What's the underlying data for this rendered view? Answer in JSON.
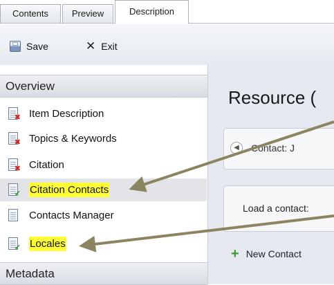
{
  "tabs": [
    {
      "label": "Contents"
    },
    {
      "label": "Preview"
    },
    {
      "label": "Description",
      "active": true
    }
  ],
  "toolbar": {
    "save_label": "Save",
    "save_icon": "floppy-disk-icon",
    "exit_label": "Exit",
    "exit_icon": "close-x-icon"
  },
  "sidebar": {
    "overview_header": "Overview",
    "metadata_header": "Metadata",
    "items": [
      {
        "label": "Item Description",
        "status": "error"
      },
      {
        "label": "Topics & Keywords",
        "status": "error"
      },
      {
        "label": "Citation",
        "status": "error"
      },
      {
        "label": "Citation Contacts",
        "status": "ok",
        "selected": true,
        "highlighted": true
      },
      {
        "label": "Contacts Manager",
        "status": "none"
      },
      {
        "label": "Locales",
        "status": "ok",
        "highlighted": true
      }
    ]
  },
  "main": {
    "title": "Resource (",
    "contact_label": "Contact: J",
    "load_label": "Load a contact:",
    "new_contact_label": "New Contact"
  },
  "colors": {
    "highlight": "#ffff33",
    "arrow": "#8c8461",
    "error_badge": "#d0231b",
    "ok_badge": "#3a9b2d"
  }
}
